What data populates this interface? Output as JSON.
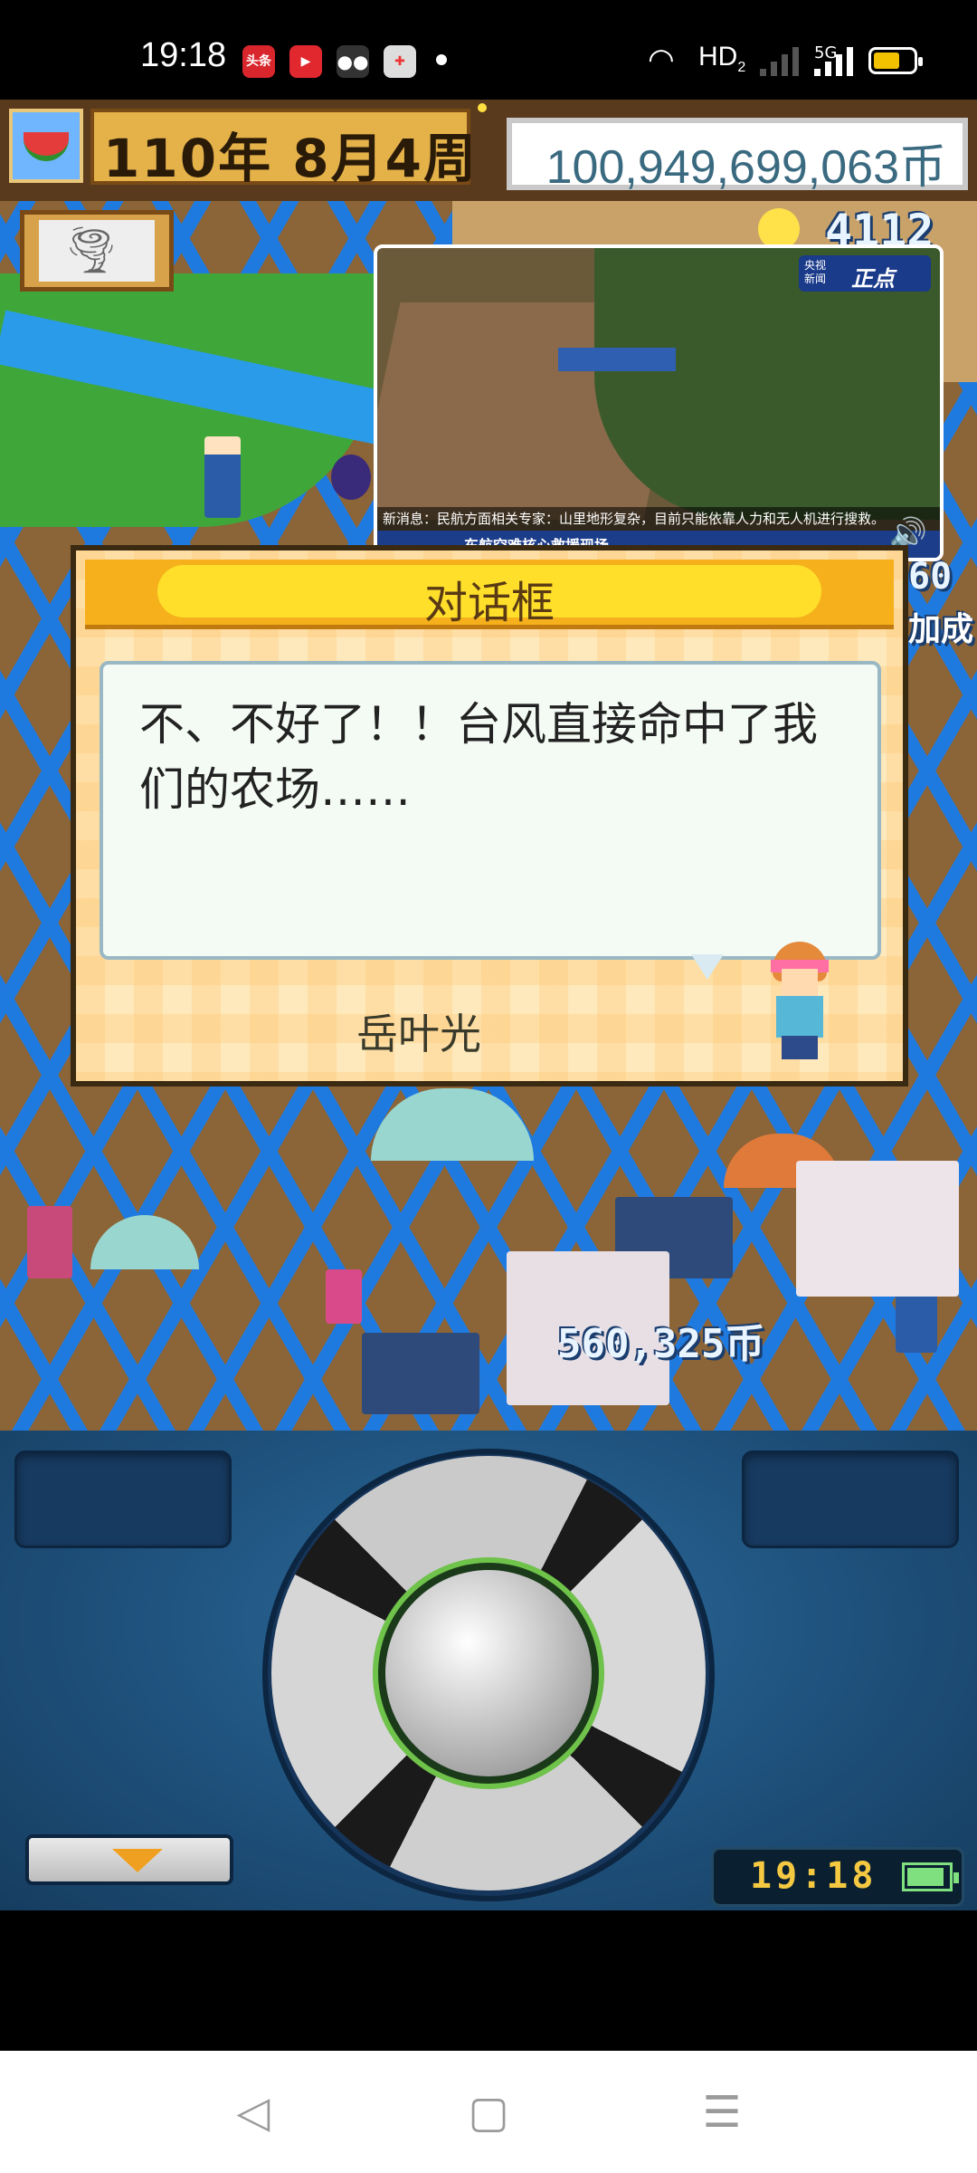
{
  "status_bar": {
    "time": "19:18",
    "app_badges": [
      "头条",
      "▶",
      "wechat",
      "game"
    ],
    "network": "HD",
    "network_sub": "2",
    "cell": "5G",
    "battery_color": "#f2c200"
  },
  "game_header": {
    "date": "110年 8月4周",
    "money": "100,949,699,063币"
  },
  "scene": {
    "top_counter": "4112",
    "side_number_1": "60",
    "side_number_2": "加成",
    "floating_money": "560,325币"
  },
  "video_overlay": {
    "logo_line1": "央视",
    "logo_line2": "新闻",
    "logo_brand": "正点",
    "ticker": "新消息：民航方面相关专家：山里地形复杂，目前只能依靠人力和无人机进行搜救。",
    "caption": "东航空难核心救援现场"
  },
  "dialog": {
    "title": "对话框",
    "text": "不、不好了！！台风直接命中了我们的农场……",
    "speaker": "岳叶光"
  },
  "controller": {
    "clock": "19:18",
    "battery_color": "#7ee07e",
    "accent_color": "#6fc24a"
  },
  "nav": {
    "back_icon": "◁",
    "home_icon": "▢",
    "menu_icon": "☰"
  }
}
